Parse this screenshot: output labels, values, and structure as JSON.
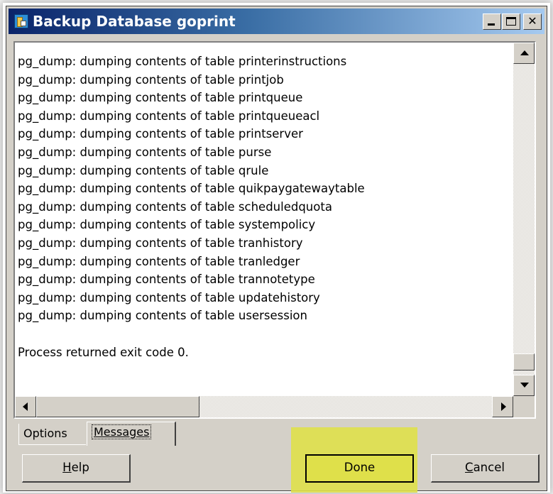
{
  "window": {
    "title": "Backup Database goprint"
  },
  "log": {
    "lines": [
      "pg_dump: dumping contents of table printerinstructions",
      "pg_dump: dumping contents of table printjob",
      "pg_dump: dumping contents of table printqueue",
      "pg_dump: dumping contents of table printqueueacl",
      "pg_dump: dumping contents of table printserver",
      "pg_dump: dumping contents of table purse",
      "pg_dump: dumping contents of table qrule",
      "pg_dump: dumping contents of table quikpaygatewaytable",
      "pg_dump: dumping contents of table scheduledquota",
      "pg_dump: dumping contents of table systempolicy",
      "pg_dump: dumping contents of table tranhistory",
      "pg_dump: dumping contents of table tranledger",
      "pg_dump: dumping contents of table trannotetype",
      "pg_dump: dumping contents of table updatehistory",
      "pg_dump: dumping contents of table usersession",
      "",
      "Process returned exit code 0."
    ]
  },
  "tabs": [
    {
      "label": "Options"
    },
    {
      "label": "Messages"
    }
  ],
  "buttons": {
    "help": {
      "prefix": "",
      "mnemonic": "H",
      "rest": "elp"
    },
    "done": {
      "label": "Done"
    },
    "cancel": {
      "prefix": "",
      "mnemonic": "C",
      "rest": "ancel"
    }
  },
  "colors": {
    "highlight": "#dfe04a",
    "titlebar": "#0a246a"
  }
}
